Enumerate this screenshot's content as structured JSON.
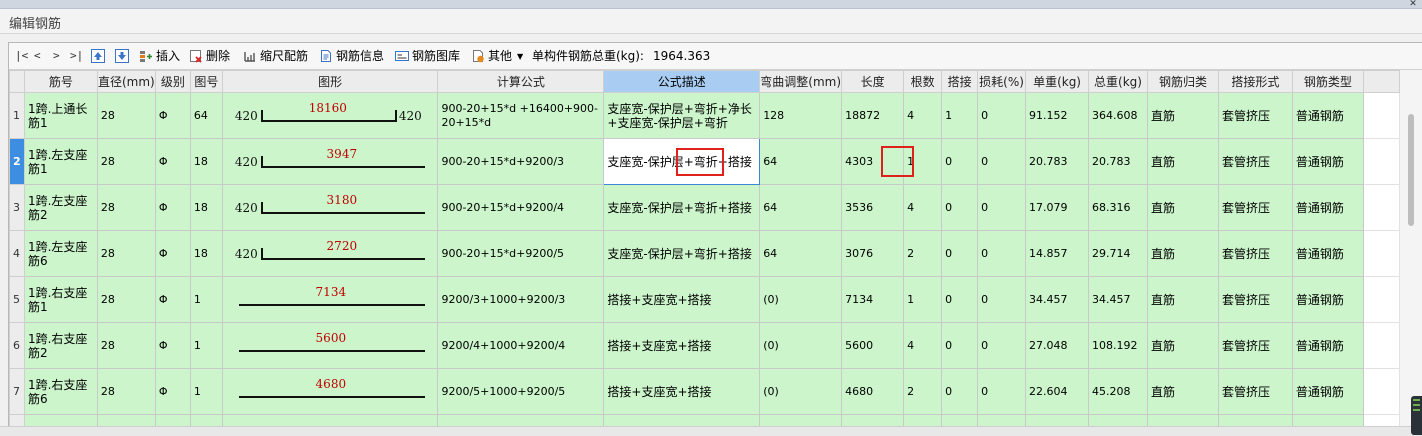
{
  "window": {
    "title": "编辑钢筋"
  },
  "toolbar": {
    "nav": {
      "first": "|<",
      "prev": "<",
      "next": ">",
      "last": ">|"
    },
    "insert": "插入",
    "delete": "删除",
    "scale": "缩尺配筋",
    "rebar_info": "钢筋信息",
    "rebar_library": "钢筋图库",
    "other": "其他",
    "total_weight_label": "单构件钢筋总重(kg):",
    "total_weight_value": "1964.363"
  },
  "table": {
    "headers": [
      "筋号",
      "直径(mm)",
      "级别",
      "图号",
      "图形",
      "计算公式",
      "公式描述",
      "弯曲调整(mm)",
      "长度",
      "根数",
      "搭接",
      "损耗(%)",
      "单重(kg)",
      "总重(kg)",
      "钢筋归类",
      "搭接形式",
      "钢筋类型"
    ],
    "active_header_index": 6,
    "rows": [
      {
        "no": "1",
        "name": "1跨.上通长筋1",
        "dia": "28",
        "grade": "Φ",
        "fig": "64",
        "shape": {
          "left": "420",
          "len": "18160",
          "right": "420"
        },
        "formula": "900-20+15*d +16400+900-20+15*d",
        "desc": "支座宽-保护层+弯折+净长+支座宽-保护层+弯折",
        "bend": "128",
        "length": "18872",
        "count": "4",
        "lap": "1",
        "loss": "0",
        "unit_w": "91.152",
        "total_w": "364.608",
        "cat": "直筋",
        "lap_type": "套管挤压",
        "type": "普通钢筋"
      },
      {
        "no": "2",
        "name": "1跨.左支座筋1",
        "dia": "28",
        "grade": "Φ",
        "fig": "18",
        "shape": {
          "left": "420",
          "len": "3947",
          "right": ""
        },
        "formula": "900-20+15*d+9200/3",
        "desc": "支座宽-保护层+弯折+搭接",
        "bend": "64",
        "length": "4303",
        "count": "1",
        "lap": "0",
        "loss": "0",
        "unit_w": "20.783",
        "total_w": "20.783",
        "cat": "直筋",
        "lap_type": "套管挤压",
        "type": "普通钢筋"
      },
      {
        "no": "3",
        "name": "1跨.左支座筋2",
        "dia": "28",
        "grade": "Φ",
        "fig": "18",
        "shape": {
          "left": "420",
          "len": "3180",
          "right": ""
        },
        "formula": "900-20+15*d+9200/4",
        "desc": "支座宽-保护层+弯折+搭接",
        "bend": "64",
        "length": "3536",
        "count": "4",
        "lap": "0",
        "loss": "0",
        "unit_w": "17.079",
        "total_w": "68.316",
        "cat": "直筋",
        "lap_type": "套管挤压",
        "type": "普通钢筋"
      },
      {
        "no": "4",
        "name": "1跨.左支座筋6",
        "dia": "28",
        "grade": "Φ",
        "fig": "18",
        "shape": {
          "left": "420",
          "len": "2720",
          "right": ""
        },
        "formula": "900-20+15*d+9200/5",
        "desc": "支座宽-保护层+弯折+搭接",
        "bend": "64",
        "length": "3076",
        "count": "2",
        "lap": "0",
        "loss": "0",
        "unit_w": "14.857",
        "total_w": "29.714",
        "cat": "直筋",
        "lap_type": "套管挤压",
        "type": "普通钢筋"
      },
      {
        "no": "5",
        "name": "1跨.右支座筋1",
        "dia": "28",
        "grade": "Φ",
        "fig": "1",
        "shape": {
          "left": "",
          "len": "7134",
          "right": ""
        },
        "formula": "9200/3+1000+9200/3",
        "desc": "搭接+支座宽+搭接",
        "bend": "(0)",
        "length": "7134",
        "count": "1",
        "lap": "0",
        "loss": "0",
        "unit_w": "34.457",
        "total_w": "34.457",
        "cat": "直筋",
        "lap_type": "套管挤压",
        "type": "普通钢筋"
      },
      {
        "no": "6",
        "name": "1跨.右支座筋2",
        "dia": "28",
        "grade": "Φ",
        "fig": "1",
        "shape": {
          "left": "",
          "len": "5600",
          "right": ""
        },
        "formula": "9200/4+1000+9200/4",
        "desc": "搭接+支座宽+搭接",
        "bend": "(0)",
        "length": "5600",
        "count": "4",
        "lap": "0",
        "loss": "0",
        "unit_w": "27.048",
        "total_w": "108.192",
        "cat": "直筋",
        "lap_type": "套管挤压",
        "type": "普通钢筋"
      },
      {
        "no": "7",
        "name": "1跨.右支座筋6",
        "dia": "28",
        "grade": "Φ",
        "fig": "1",
        "shape": {
          "left": "",
          "len": "4680",
          "right": ""
        },
        "formula": "9200/5+1000+9200/5",
        "desc": "搭接+支座宽+搭接",
        "bend": "(0)",
        "length": "4680",
        "count": "2",
        "lap": "0",
        "loss": "0",
        "unit_w": "22.604",
        "total_w": "45.208",
        "cat": "直筋",
        "lap_type": "套管挤压",
        "type": "普通钢筋"
      }
    ],
    "selected_row": 2
  },
  "colors": {
    "row_bg": "#ccf5cc",
    "header_bg": "#ececec",
    "active_header_bg": "#a9cdf2",
    "selected_row_marker": "#3d8de0",
    "dimension_text": "#c00000",
    "highlight_box": "#e0201a"
  },
  "icons": [
    "move-up-icon",
    "move-down-icon",
    "insert-icon",
    "delete-icon",
    "scale-rebar-icon",
    "rebar-info-icon",
    "rebar-library-icon",
    "other-icon",
    "dropdown-arrow-icon"
  ]
}
